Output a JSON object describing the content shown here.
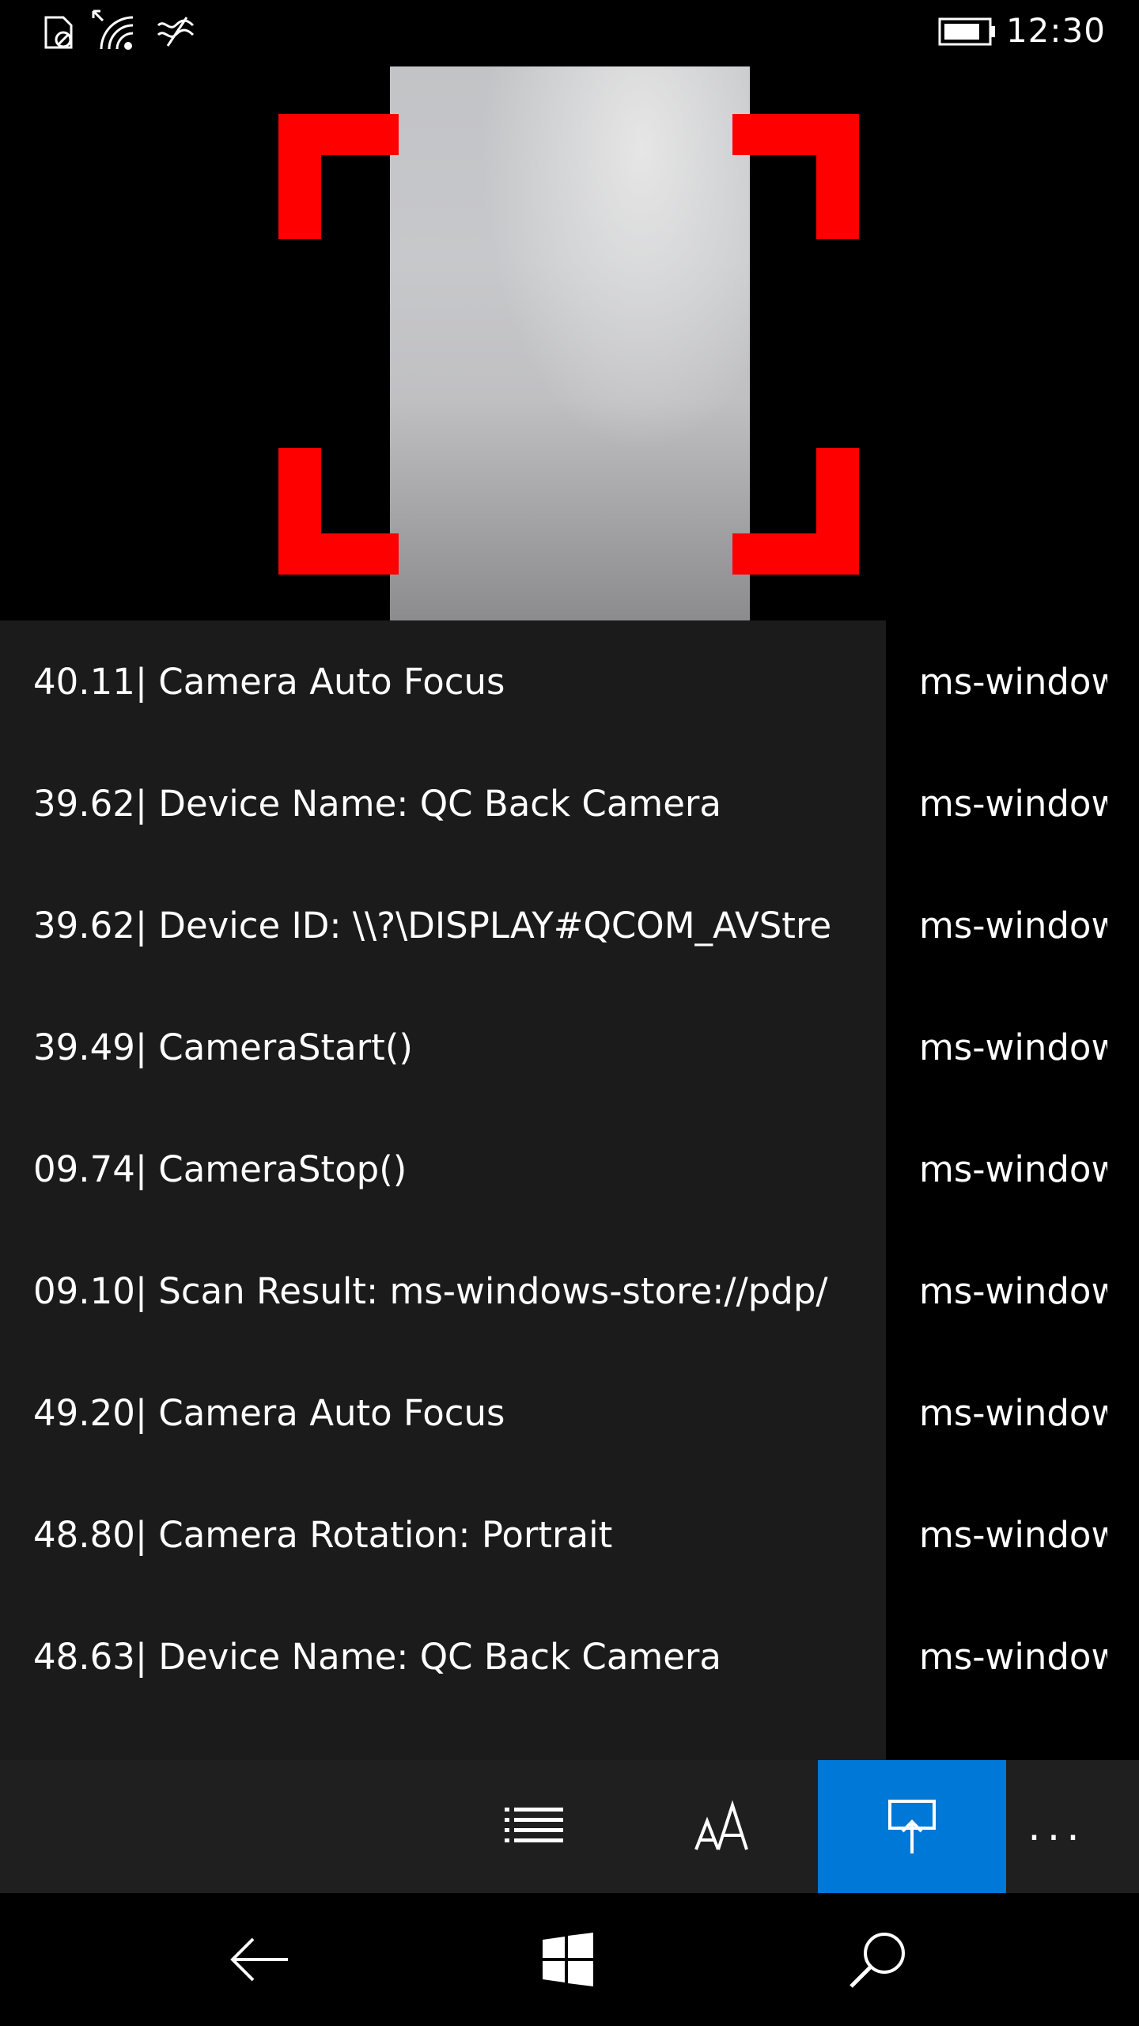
{
  "status_bar": {
    "time": "12:30",
    "icons": [
      "no-sim-icon",
      "wifi-icon",
      "data-connection-icon",
      "battery-icon"
    ]
  },
  "camera": {
    "bracket_color": "#ff0000"
  },
  "log": {
    "entries": [
      {
        "text": "40.11| Camera Auto Focus",
        "detail": "ms-windows-store://pdp/"
      },
      {
        "text": "39.62| Device Name: QC Back Camera",
        "detail": "ms-windows-store://pdp/"
      },
      {
        "text": "39.62| Device ID: \\\\?\\DISPLAY#QCOM_AVStre",
        "detail": "ms-windows-store://pdp/"
      },
      {
        "text": "39.49| CameraStart()",
        "detail": "ms-windows-store://pdp/"
      },
      {
        "text": "09.74| CameraStop()",
        "detail": "ms-windows-store://pdp/"
      },
      {
        "text": "09.10| Scan Result: ms-windows-store://pdp/",
        "detail": "ms-windows-store://pdp/"
      },
      {
        "text": "49.20| Camera Auto Focus",
        "detail": "ms-windows-store://pdp/"
      },
      {
        "text": "48.80| Camera Rotation: Portrait",
        "detail": "ms-windows-store://pdp/"
      },
      {
        "text": "48.63| Device Name: QC Back Camera",
        "detail": "ms-windows-store://pdp/"
      }
    ]
  },
  "app_bar": {
    "buttons": [
      "list-icon",
      "font-size-icon",
      "project-screen-icon"
    ],
    "active_color": "#0078d7",
    "more_label": "..."
  },
  "nav_bar": {
    "buttons": [
      "back-arrow-icon",
      "windows-logo-icon",
      "search-icon"
    ]
  }
}
